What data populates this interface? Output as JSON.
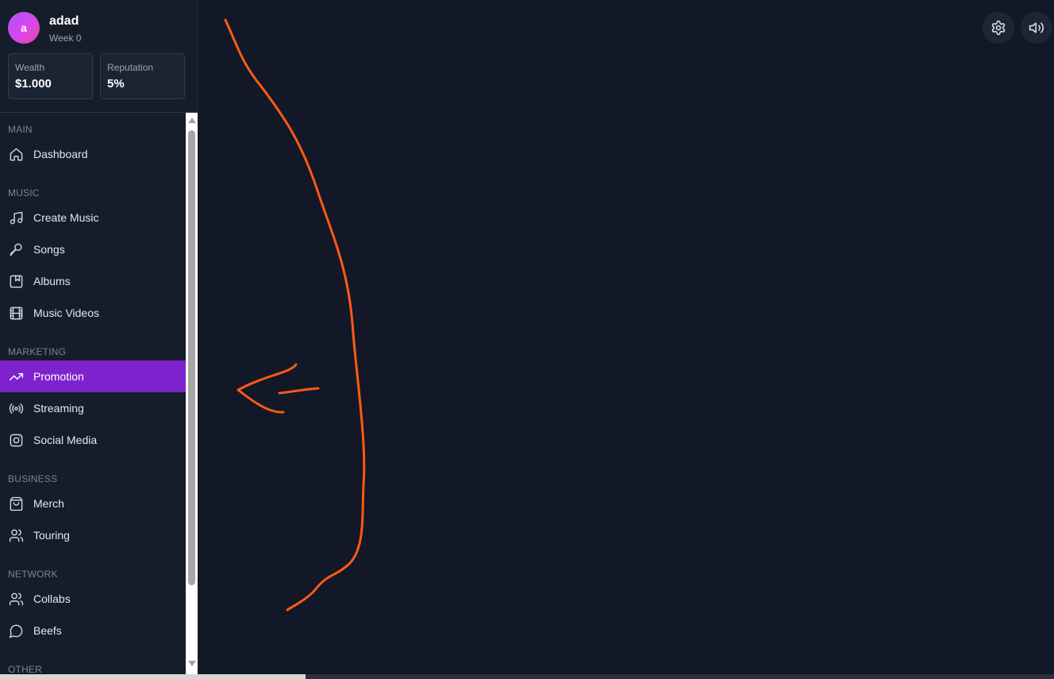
{
  "profile": {
    "avatar_initial": "a",
    "username": "adad",
    "week": "Week 0",
    "stats": [
      {
        "label": "Wealth",
        "value": "$1.000"
      },
      {
        "label": "Reputation",
        "value": "5%"
      }
    ]
  },
  "sections": [
    {
      "label": "MAIN"
    },
    {
      "label": "MUSIC"
    },
    {
      "label": "MARKETING"
    },
    {
      "label": "BUSINESS"
    },
    {
      "label": "NETWORK"
    },
    {
      "label": "OTHER"
    }
  ],
  "nav": [
    {
      "label": "Dashboard",
      "icon": "home-icon"
    },
    {
      "label": "Create Music",
      "icon": "music-note-icon"
    },
    {
      "label": "Songs",
      "icon": "microphone-icon"
    },
    {
      "label": "Albums",
      "icon": "album-icon"
    },
    {
      "label": "Music Videos",
      "icon": "film-icon"
    },
    {
      "label": "Promotion",
      "icon": "trending-up-icon",
      "active": true
    },
    {
      "label": "Streaming",
      "icon": "radio-icon"
    },
    {
      "label": "Social Media",
      "icon": "instagram-icon"
    },
    {
      "label": "Merch",
      "icon": "shopping-bag-icon"
    },
    {
      "label": "Touring",
      "icon": "users-icon"
    },
    {
      "label": "Collabs",
      "icon": "users-icon"
    },
    {
      "label": "Beefs",
      "icon": "chat-bubble-icon"
    }
  ],
  "topbar": {
    "settings_icon": "gear-icon",
    "sound_icon": "volume-icon"
  },
  "colors": {
    "background": "#121827",
    "sidebar": "#151d2b",
    "active_item": "#7e22ce",
    "annotation_stroke": "#ff5a14"
  }
}
